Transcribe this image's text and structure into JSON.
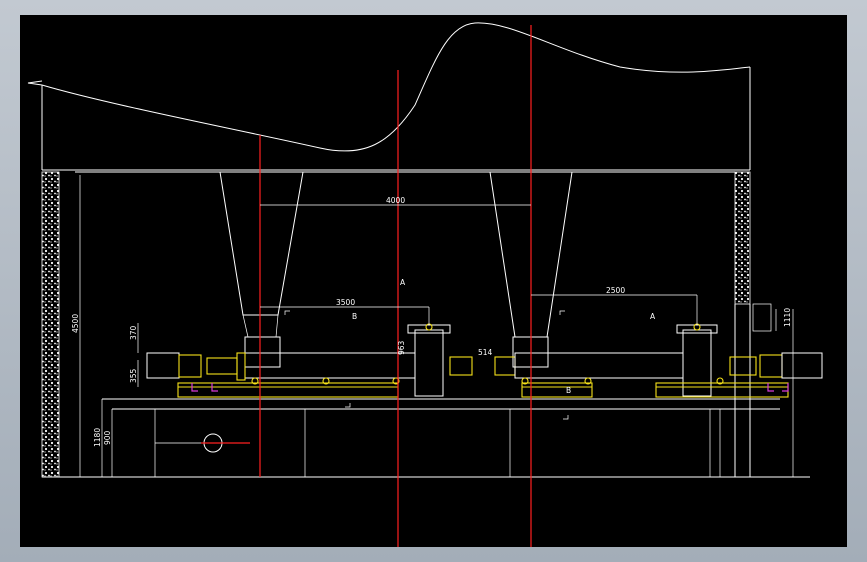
{
  "colors": {
    "background": "#000000",
    "line": "#ffffff",
    "centerline": "#ff2020",
    "equipment": "#f6e21a",
    "accent": "#d63bd6"
  },
  "dimensions": {
    "d4000": "4000",
    "d3500": "3500",
    "d2500": "2500",
    "d4500": "4500",
    "d370": "370",
    "d355": "355",
    "d963": "963",
    "d514": "514",
    "d1180": "1180",
    "d900": "900",
    "d1110": "1110"
  },
  "labels": {
    "a1": "A",
    "a2": "A",
    "b1": "B",
    "b2": "B"
  }
}
